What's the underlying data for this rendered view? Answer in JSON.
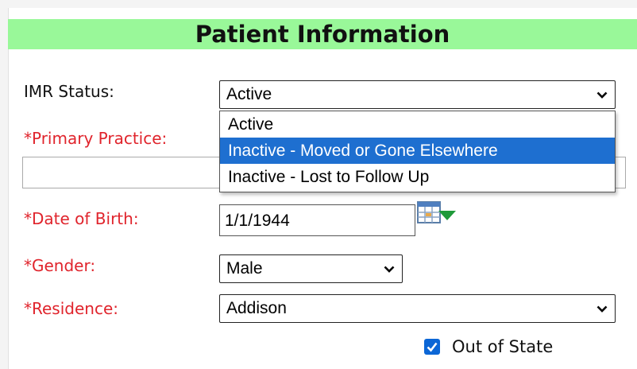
{
  "header": {
    "title": "Patient Information"
  },
  "form": {
    "imr_status": {
      "label": "IMR Status:",
      "value": "Active",
      "options": [
        "Active",
        "Inactive - Moved or Gone Elsewhere",
        "Inactive - Lost to Follow Up"
      ],
      "highlighted_option": "Inactive - Moved or Gone Elsewhere"
    },
    "primary_practice": {
      "label": "*Primary Practice:",
      "value": ""
    },
    "date_of_birth": {
      "label": "*Date of Birth:",
      "value": "1/1/1944"
    },
    "gender": {
      "label": "*Gender:",
      "value": "Male"
    },
    "residence": {
      "label": "*Residence:",
      "value": "Addison"
    },
    "out_of_state": {
      "label": "Out of State",
      "checked": true
    }
  },
  "colors": {
    "header_bg": "#99f899",
    "required_label": "#e0242c",
    "highlight": "#1e6fd0",
    "checkbox": "#0b66d6"
  },
  "icons": {
    "calendar": "calendar-icon",
    "chevron": "chevron-down-icon",
    "check": "checkmark-icon"
  }
}
